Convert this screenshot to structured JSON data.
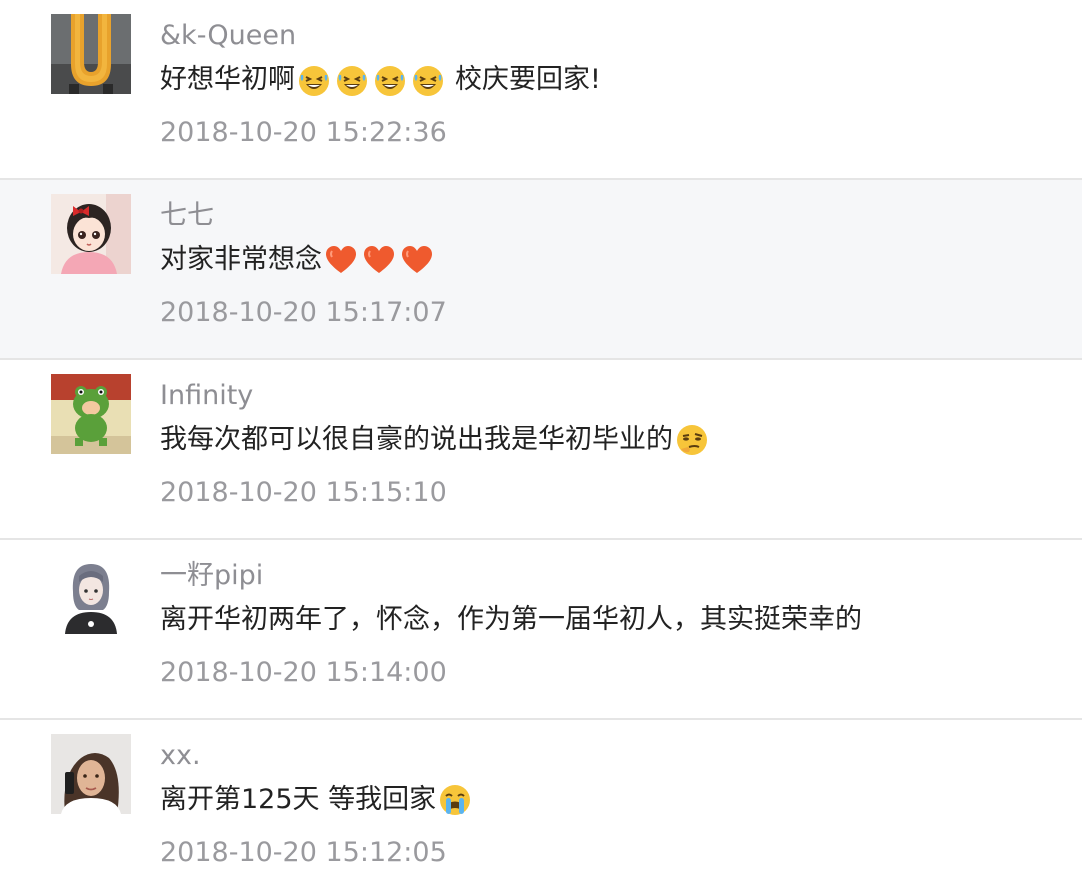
{
  "comments": [
    {
      "name": "&k-Queen",
      "text": "好想华初啊",
      "emojis": [
        "grinning-squint-sweat",
        "grinning-squint-sweat",
        "grinning-squint-sweat",
        "grinning-squint-sweat"
      ],
      "text_after": "校庆要回家!",
      "time": "2018-10-20 15:22:36"
    },
    {
      "name": "七七",
      "text": "对家非常想念",
      "emojis": [
        "heart",
        "heart",
        "heart"
      ],
      "text_after": "",
      "time": "2018-10-20 15:17:07"
    },
    {
      "name": "Infinity",
      "text": "我每次都可以很自豪的说出我是华初毕业的",
      "emojis": [
        "smirk-thinking"
      ],
      "text_after": "",
      "time": "2018-10-20 15:15:10"
    },
    {
      "name": "一籽pipi",
      "text": "离开华初两年了，怀念，作为第一届华初人，其实挺荣幸的",
      "emojis": [],
      "text_after": "",
      "time": "2018-10-20 15:14:00"
    },
    {
      "name": "xx.",
      "text": "离开第125天 等我回家",
      "emojis": [
        "crying-face"
      ],
      "text_after": "",
      "time": "2018-10-20 15:12:05"
    }
  ],
  "colors": {
    "name": "#8e8e93",
    "text": "#222222",
    "time": "#9a9a9e",
    "divider": "#e5e5e5",
    "highlight_bg": "#f6f7f9"
  }
}
